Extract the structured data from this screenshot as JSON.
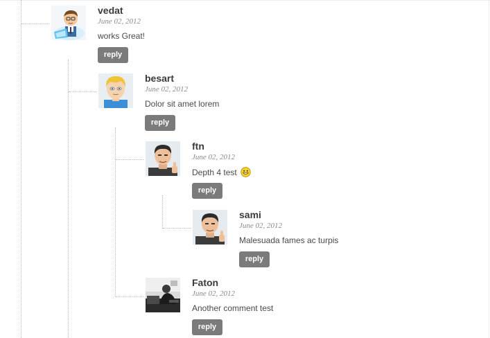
{
  "comments": [
    {
      "author": "vedat",
      "date": "June 02, 2012",
      "text": "works Great!",
      "reply_label": "reply",
      "avatar": "cartoon-man-laptop-avatar"
    },
    {
      "author": "besart",
      "date": "June 02, 2012",
      "text": "Dolor sit amet lorem",
      "reply_label": "reply",
      "avatar": "cartoon-blond-man-avatar"
    },
    {
      "author": "ftn",
      "date": "June 02, 2012",
      "text": "Depth 4 test",
      "reply_label": "reply",
      "avatar": "cartoon-man-thumbs-up-avatar",
      "emoji": "smiley-face-icon"
    },
    {
      "author": "sami",
      "date": "June 02, 2012",
      "text": "Malesuada fames ac turpis",
      "reply_label": "reply",
      "avatar": "cartoon-man-thumbs-up-avatar"
    },
    {
      "author": "Faton",
      "date": "June 02, 2012",
      "text": "Another comment test",
      "reply_label": "reply",
      "avatar": "photo-avatar"
    }
  ]
}
